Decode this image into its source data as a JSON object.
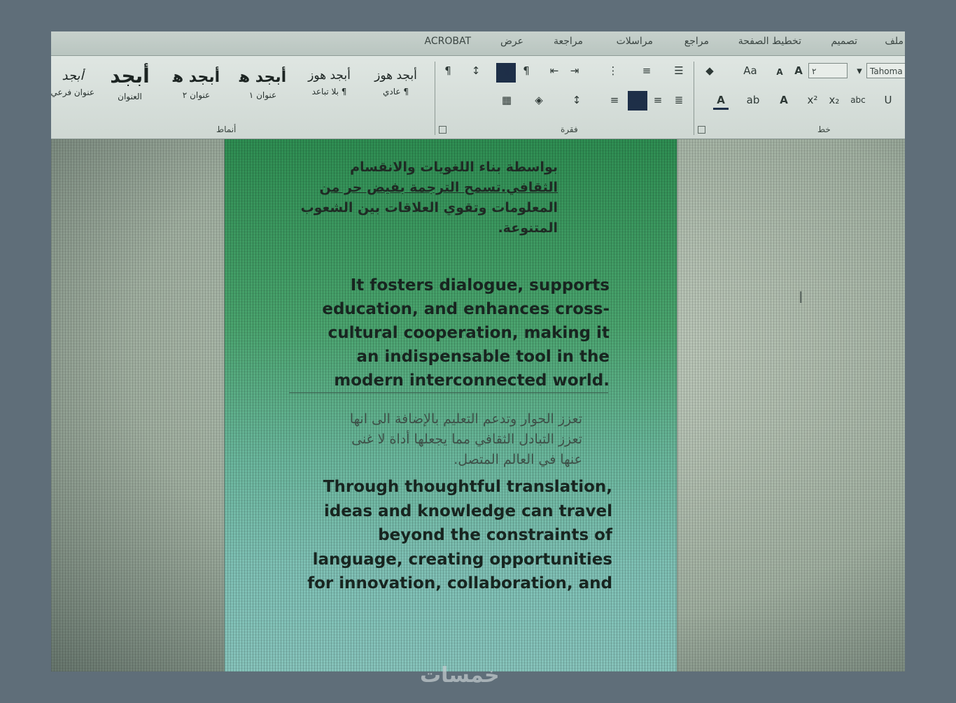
{
  "ribbon_tabs": [
    "ملف",
    "تصميم",
    "تخطيط الصفحة",
    "مراجع",
    "مراسلات",
    "مراجعة",
    "عرض",
    "ACROBAT"
  ],
  "font_group": {
    "label": "خط",
    "font_name": "Tahoma",
    "font_size": "٢",
    "grow_label": "A",
    "shrink_label": "A",
    "change_case_label": "Aa",
    "superscript_label": "x²",
    "subscript_label": "x₂",
    "strike_label": "abc"
  },
  "paragraph_group": {
    "label": "فقرة"
  },
  "styles_group": {
    "label": "أنماط",
    "styles": [
      {
        "preview": "أبجد هوز",
        "name": "¶ عادي"
      },
      {
        "preview": "أبجد هوز",
        "name": "¶ بلا تباعد"
      },
      {
        "preview": "أبجد ﻫ",
        "name": "عنوان ١"
      },
      {
        "preview": "أبجد ﻫ",
        "name": "عنوان ٢"
      },
      {
        "preview": "أبجد",
        "name": "العنوان"
      },
      {
        "preview": "أبجد",
        "name": "عنوان فرعي"
      }
    ]
  },
  "document": {
    "arabic_1": [
      "بواسطة بناء اللغويات والانقسام",
      "الثقافي.تسمح الترجمة بفيض حر من",
      "المعلومات وتقوي العلاقات بين الشعوب",
      "المتنوعة."
    ],
    "english_1": [
      "It fosters dialogue, supports",
      "education, and enhances cross-",
      "cultural cooperation, making it",
      "an indispensable tool in the",
      "modern interconnected world."
    ],
    "arabic_2": [
      "تعزز الحوار وتدعم التعليم بالإضافة الى انها",
      "تعزز التبادل الثقافي مما يجعلها أداة لا غنى",
      "عنها في العالم المتصل."
    ],
    "english_2": [
      "Through thoughtful translation,",
      "ideas and knowledge can travel",
      "beyond the constraints of",
      "language, creating opportunities",
      "for innovation, collaboration, and"
    ]
  },
  "watermark": "خمسات",
  "colors": {
    "page_top": "#2e8d52",
    "page_bottom": "#86c3bb",
    "highlight_button": "#1e2f48",
    "background": "#5f6e79"
  }
}
